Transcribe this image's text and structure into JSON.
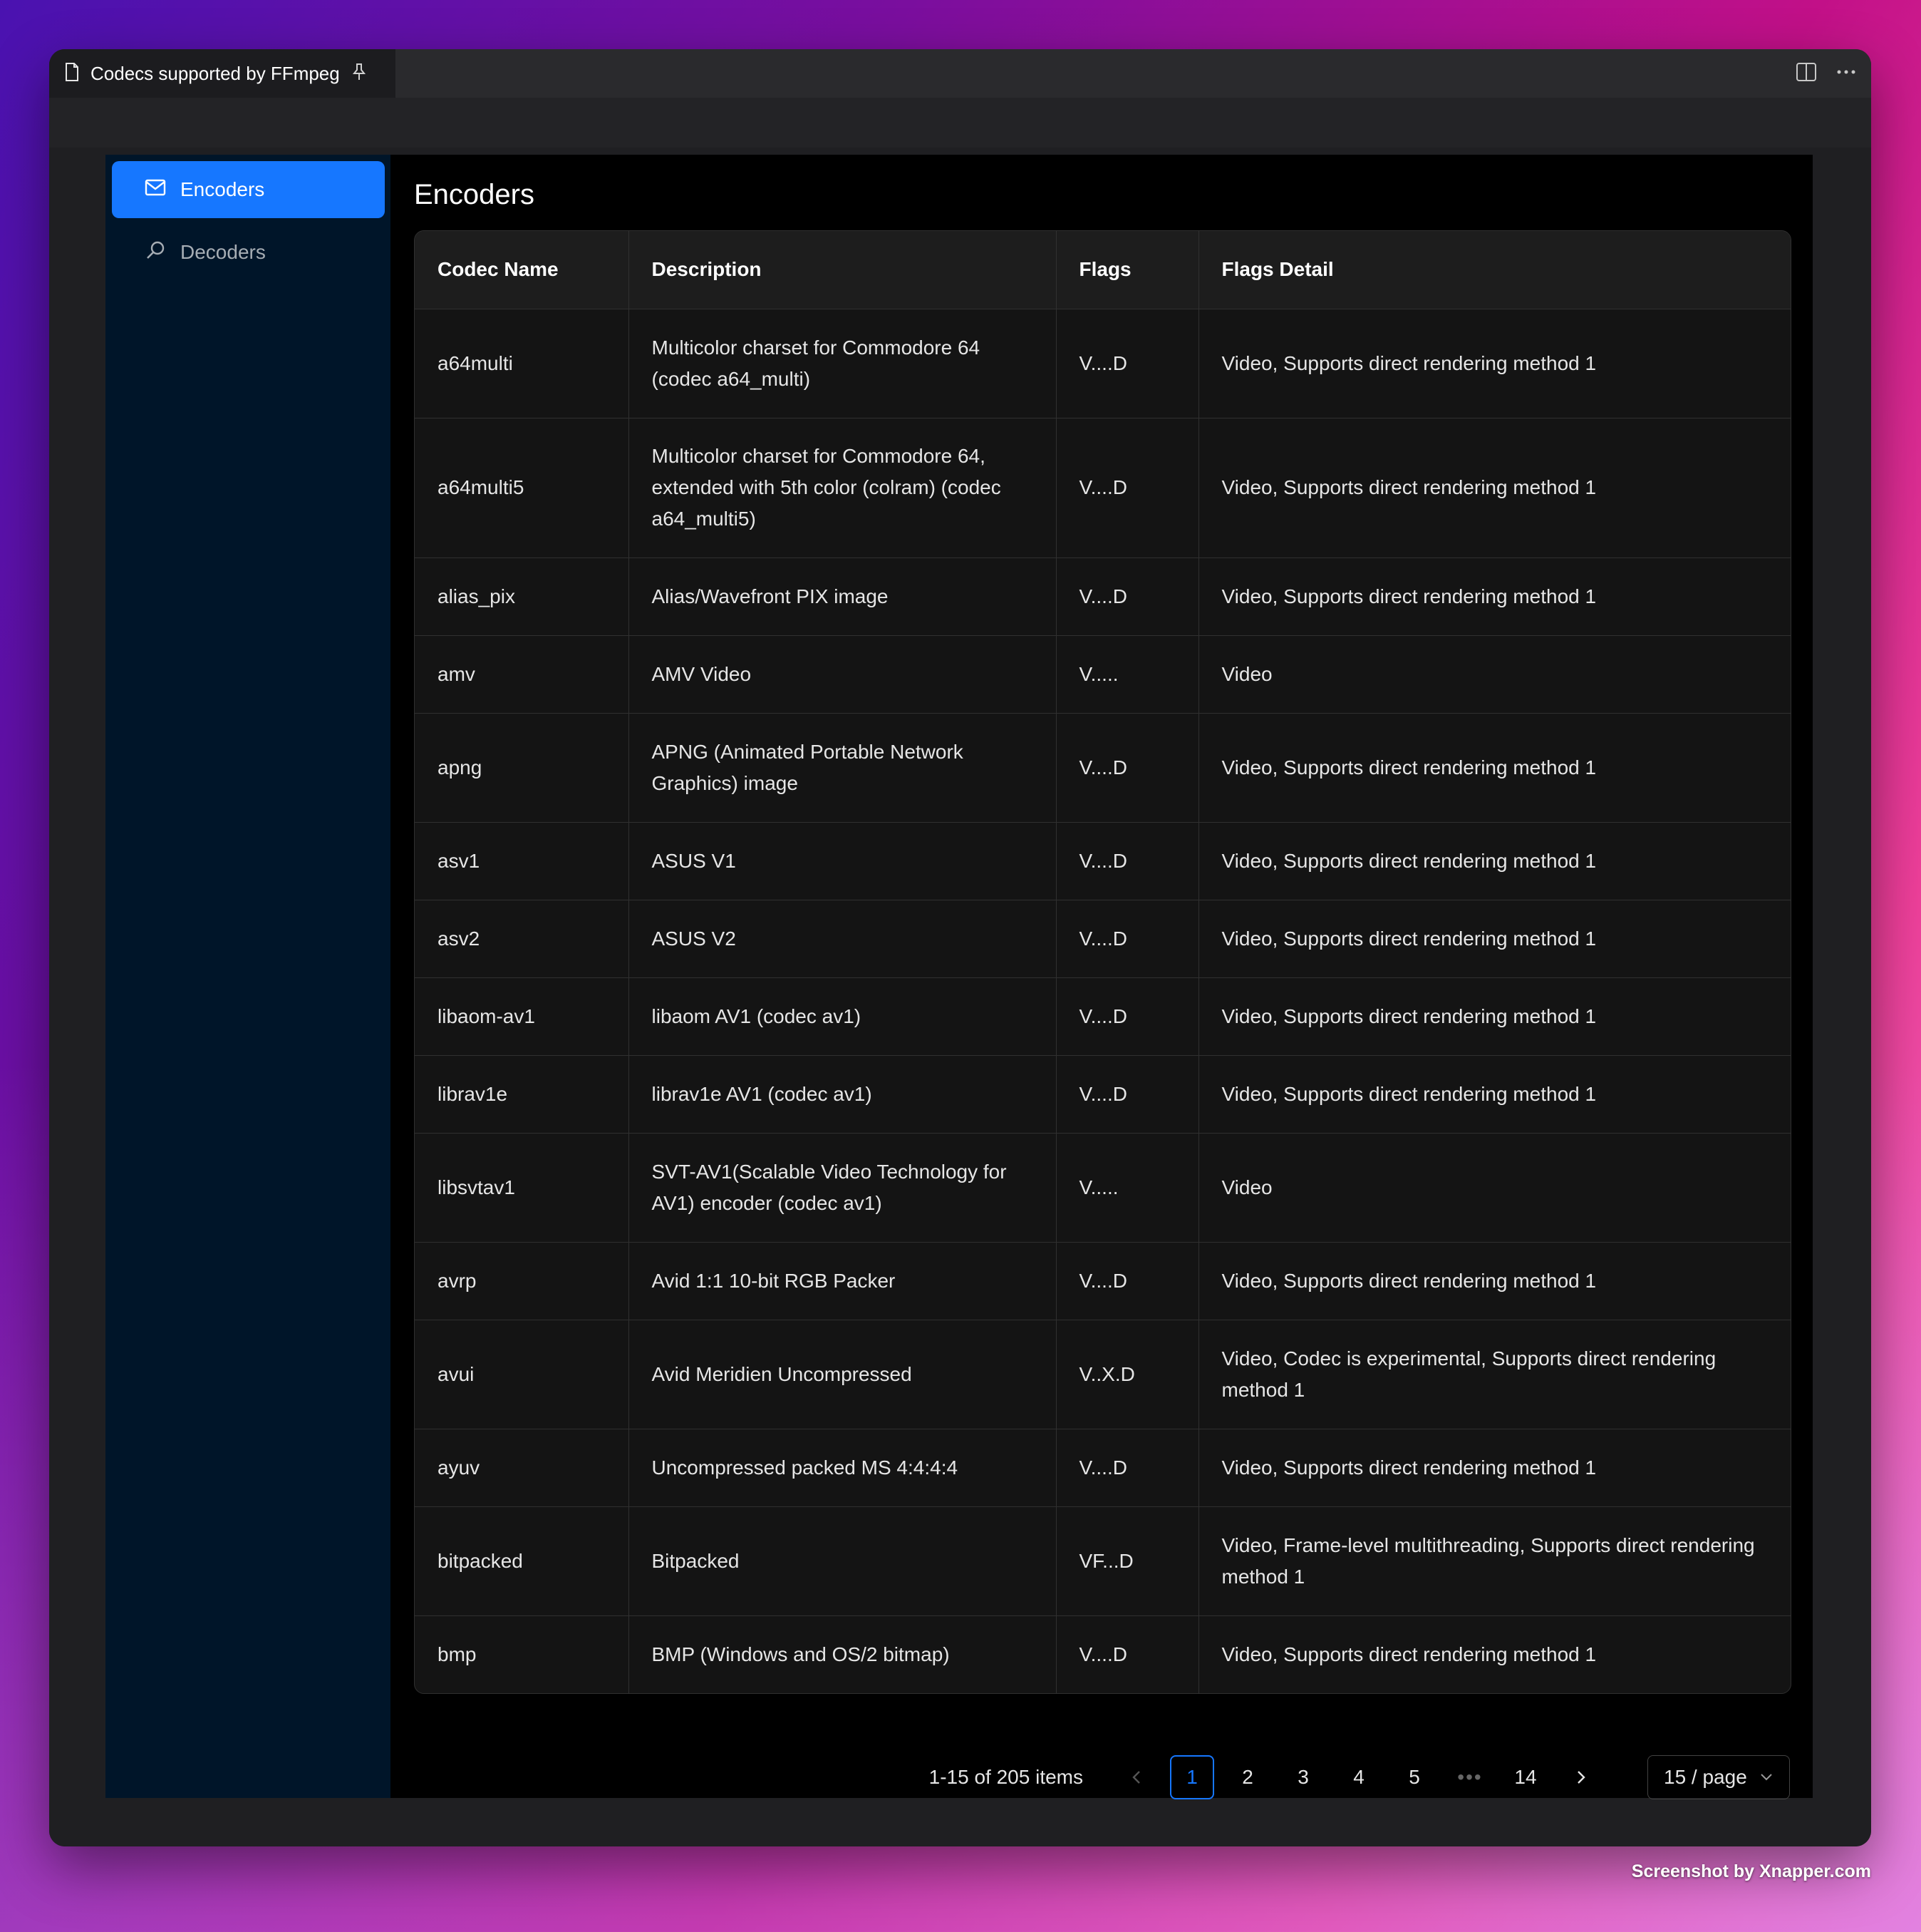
{
  "window": {
    "tab_title": "Codecs supported by FFmpeg"
  },
  "sidebar": {
    "items": [
      {
        "label": "Encoders",
        "icon": "mail-icon",
        "active": true
      },
      {
        "label": "Decoders",
        "icon": "search-icon",
        "active": false
      }
    ]
  },
  "main": {
    "title": "Encoders",
    "table": {
      "columns": [
        "Codec Name",
        "Description",
        "Flags",
        "Flags Detail"
      ],
      "rows": [
        {
          "name": "a64multi",
          "description": "Multicolor charset for Commodore 64 (codec a64_multi)",
          "flags": "V....D",
          "detail": "Video, Supports direct rendering method 1"
        },
        {
          "name": "a64multi5",
          "description": "Multicolor charset for Commodore 64, extended with 5th color (colram) (codec a64_multi5)",
          "flags": "V....D",
          "detail": "Video, Supports direct rendering method 1"
        },
        {
          "name": "alias_pix",
          "description": "Alias/Wavefront PIX image",
          "flags": "V....D",
          "detail": "Video, Supports direct rendering method 1"
        },
        {
          "name": "amv",
          "description": "AMV Video",
          "flags": "V.....",
          "detail": "Video"
        },
        {
          "name": "apng",
          "description": "APNG (Animated Portable Network Graphics) image",
          "flags": "V....D",
          "detail": "Video, Supports direct rendering method 1"
        },
        {
          "name": "asv1",
          "description": "ASUS V1",
          "flags": "V....D",
          "detail": "Video, Supports direct rendering method 1"
        },
        {
          "name": "asv2",
          "description": "ASUS V2",
          "flags": "V....D",
          "detail": "Video, Supports direct rendering method 1"
        },
        {
          "name": "libaom-av1",
          "description": "libaom AV1 (codec av1)",
          "flags": "V....D",
          "detail": "Video, Supports direct rendering method 1"
        },
        {
          "name": "librav1e",
          "description": "librav1e AV1 (codec av1)",
          "flags": "V....D",
          "detail": "Video, Supports direct rendering method 1"
        },
        {
          "name": "libsvtav1",
          "description": "SVT-AV1(Scalable Video Technology for AV1) encoder (codec av1)",
          "flags": "V.....",
          "detail": "Video"
        },
        {
          "name": "avrp",
          "description": "Avid 1:1 10-bit RGB Packer",
          "flags": "V....D",
          "detail": "Video, Supports direct rendering method 1"
        },
        {
          "name": "avui",
          "description": "Avid Meridien Uncompressed",
          "flags": "V..X.D",
          "detail": "Video, Codec is experimental, Supports direct rendering method 1"
        },
        {
          "name": "ayuv",
          "description": "Uncompressed packed MS 4:4:4:4",
          "flags": "V....D",
          "detail": "Video, Supports direct rendering method 1"
        },
        {
          "name": "bitpacked",
          "description": "Bitpacked",
          "flags": "VF...D",
          "detail": "Video, Frame-level multithreading, Supports direct rendering method 1"
        },
        {
          "name": "bmp",
          "description": "BMP (Windows and OS/2 bitmap)",
          "flags": "V....D",
          "detail": "Video, Supports direct rendering method 1"
        }
      ]
    },
    "pagination": {
      "total_text": "1-15 of 205 items",
      "pages": [
        "1",
        "2",
        "3",
        "4",
        "5",
        "•••",
        "14"
      ],
      "current_page": "1",
      "page_size": "15 / page"
    }
  },
  "watermark": "Screenshot by Xnapper.com",
  "colors": {
    "accent": "#1677ff",
    "sidebar_bg": "#001529"
  }
}
